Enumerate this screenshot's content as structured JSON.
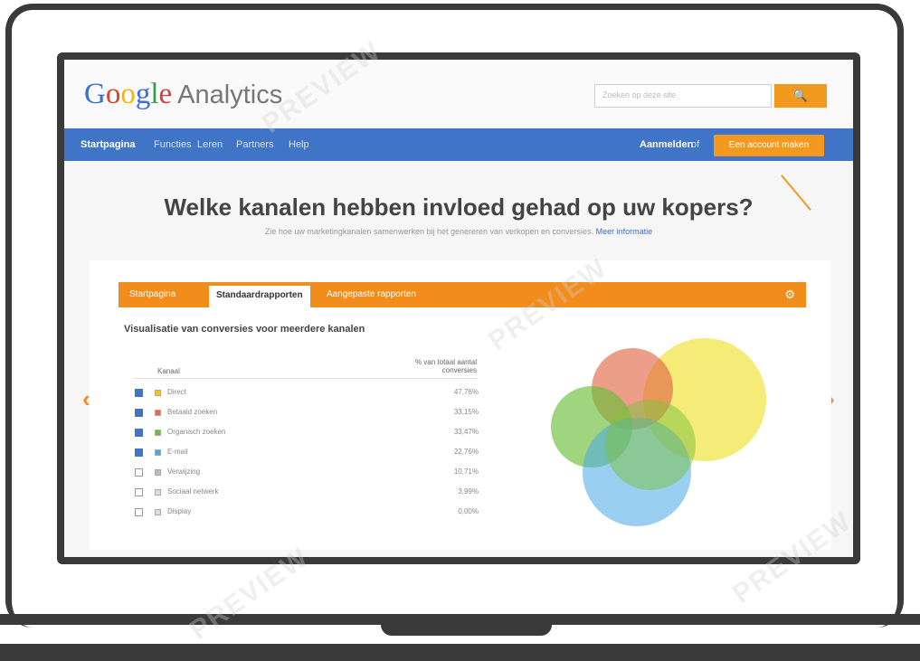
{
  "app": {
    "logo": {
      "G": "G",
      "o1": "o",
      "o2": "o",
      "g": "g",
      "l": "l",
      "e": "e",
      "analytics": "Analytics"
    },
    "search": {
      "placeholder": "Zoeken op deze site",
      "button": "🔍"
    }
  },
  "nav": {
    "items": [
      "Startpagina",
      "Functies",
      "Leren",
      "Partners",
      "Help"
    ],
    "signin": "Aanmelden",
    "separator": "of",
    "create_account": "Een account maken"
  },
  "hero": {
    "title": "Welke kanalen hebben invloed gehad op uw kopers?",
    "subtitle": "Zie hoe uw marketingkanalen samenwerken bij het genereren van verkopen en conversies.",
    "link": "Meer informatie"
  },
  "report": {
    "tabs": [
      "Startpagina",
      "Standaardrapporten",
      "Aangepaste rapporten"
    ],
    "title": "Visualisatie van conversies voor meerdere kanalen",
    "col_channel": "Kanaal",
    "col_pct": "% van totaal aantal conversies",
    "rows": [
      {
        "label": "Direct",
        "pct": "47,76%",
        "checked": true,
        "color": "#f5c518"
      },
      {
        "label": "Betaald zoeken",
        "pct": "33,15%",
        "checked": true,
        "color": "#e26a4a"
      },
      {
        "label": "Organisch zoeken",
        "pct": "33,47%",
        "checked": true,
        "color": "#6bbf3a"
      },
      {
        "label": "E-mail",
        "pct": "22,76%",
        "checked": true,
        "color": "#49a8e6"
      },
      {
        "label": "Verwijzing",
        "pct": "10,71%",
        "checked": false,
        "color": "#bbbbbb"
      },
      {
        "label": "Sociaal netwerk",
        "pct": "3,99%",
        "checked": false,
        "color": "#dddddd"
      },
      {
        "label": "Display",
        "pct": "0,00%",
        "checked": false,
        "color": "#dddddd"
      }
    ]
  },
  "carousel": {
    "prev": "‹",
    "next": "›"
  },
  "watermark": "PREVIEW"
}
